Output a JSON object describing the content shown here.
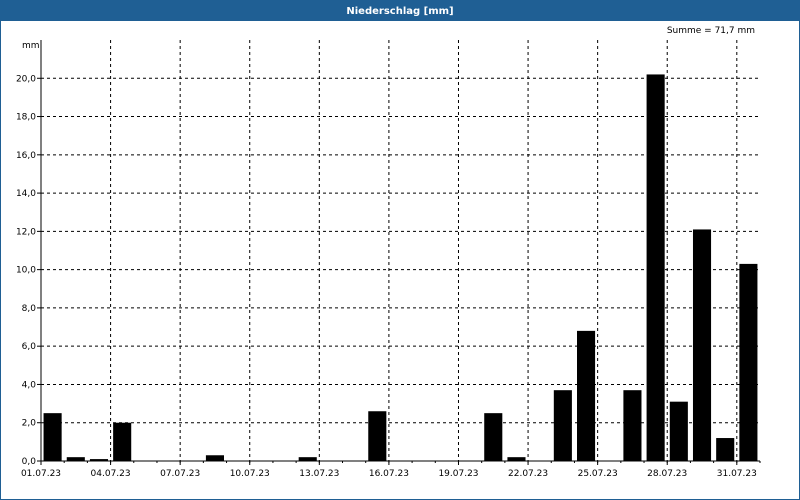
{
  "window": {
    "title": "Niederschlag [mm]",
    "summary": "Summe = 71,7 mm"
  },
  "chart_data": {
    "type": "bar",
    "title": "Niederschlag [mm]",
    "ylabel": "mm",
    "ylim": [
      0,
      22
    ],
    "yticks": [
      0,
      2,
      4,
      6,
      8,
      10,
      12,
      14,
      16,
      18,
      20
    ],
    "ytick_labels": [
      "0,0",
      "2,0",
      "4,0",
      "6,0",
      "8,0",
      "10,0",
      "12,0",
      "14,0",
      "16,0",
      "18,0",
      "20,0"
    ],
    "grid": true,
    "categories": [
      "01.07.23",
      "02.07.23",
      "03.07.23",
      "04.07.23",
      "05.07.23",
      "06.07.23",
      "07.07.23",
      "08.07.23",
      "09.07.23",
      "10.07.23",
      "11.07.23",
      "12.07.23",
      "13.07.23",
      "14.07.23",
      "15.07.23",
      "16.07.23",
      "17.07.23",
      "18.07.23",
      "19.07.23",
      "20.07.23",
      "21.07.23",
      "22.07.23",
      "23.07.23",
      "24.07.23",
      "25.07.23",
      "26.07.23",
      "27.07.23",
      "28.07.23",
      "29.07.23",
      "30.07.23",
      "31.07.23"
    ],
    "xtick_labels": [
      "01.07.23",
      "04.07.23",
      "07.07.23",
      "10.07.23",
      "13.07.23",
      "16.07.23",
      "19.07.23",
      "22.07.23",
      "25.07.23",
      "28.07.23",
      "31.07.23"
    ],
    "values": [
      2.5,
      0.2,
      0.1,
      2.0,
      0,
      0,
      0,
      0.3,
      0,
      0,
      0,
      0.2,
      0,
      0,
      2.6,
      0,
      0,
      0,
      0,
      2.5,
      0.2,
      0,
      3.7,
      6.8,
      0,
      3.7,
      20.2,
      3.1,
      12.1,
      1.2,
      10.3
    ],
    "bar_color": "#000000",
    "grid_color": "#000000"
  }
}
